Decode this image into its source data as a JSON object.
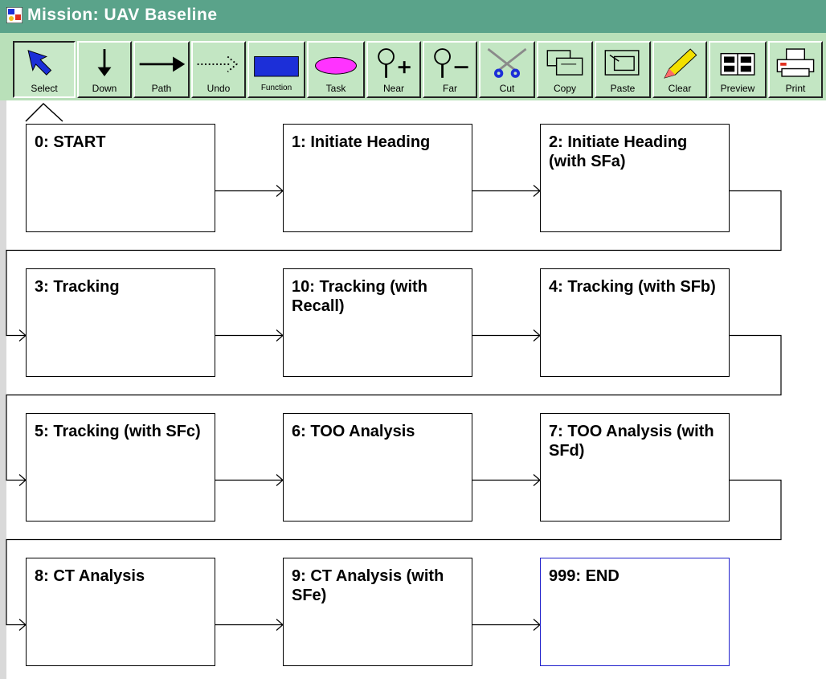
{
  "window": {
    "title": "Mission: UAV Baseline"
  },
  "toolbar": {
    "buttons": [
      {
        "label": "Select",
        "icon": "select-arrow-icon",
        "selected": true
      },
      {
        "label": "Down",
        "icon": "down-arrow-icon"
      },
      {
        "label": "Path",
        "icon": "path-arrow-icon"
      },
      {
        "label": "Undo",
        "icon": "undo-dotted-arrow-icon"
      },
      {
        "label": "Function",
        "icon": "function-rectangle-icon"
      },
      {
        "label": "Task",
        "icon": "task-ellipse-icon"
      },
      {
        "label": "Near",
        "icon": "zoom-in-icon"
      },
      {
        "label": "Far",
        "icon": "zoom-out-icon"
      },
      {
        "label": "Cut",
        "icon": "scissors-icon"
      },
      {
        "label": "Copy",
        "icon": "copy-icon"
      },
      {
        "label": "Paste",
        "icon": "paste-icon"
      },
      {
        "label": "Clear",
        "icon": "eraser-pencil-icon"
      },
      {
        "label": "Preview",
        "icon": "preview-icon"
      },
      {
        "label": "Print",
        "icon": "printer-icon"
      }
    ]
  },
  "colors": {
    "titlebar": "#5aa38a",
    "toolbar": "#b9e0b9",
    "function_button": "#1c2fd8",
    "task_button": "#ff33ff",
    "end_node_border": "#2020cc"
  },
  "diagram": {
    "nodes": [
      {
        "id": "0",
        "label": "0: START"
      },
      {
        "id": "1",
        "label": "1: Initiate Heading"
      },
      {
        "id": "2",
        "label": "2: Initiate Heading (with SFa)"
      },
      {
        "id": "3",
        "label": "3: Tracking"
      },
      {
        "id": "10",
        "label": "10: Tracking (with Recall)"
      },
      {
        "id": "4",
        "label": "4: Tracking (with SFb)"
      },
      {
        "id": "5",
        "label": "5: Tracking (with SFc)"
      },
      {
        "id": "6",
        "label": "6: TOO Analysis"
      },
      {
        "id": "7",
        "label": "7: TOO Analysis (with SFd)"
      },
      {
        "id": "8",
        "label": "8: CT Analysis"
      },
      {
        "id": "9",
        "label": "9: CT Analysis (with SFe)"
      },
      {
        "id": "999",
        "label": "999: END",
        "end": true
      }
    ],
    "edges": [
      [
        "0",
        "1"
      ],
      [
        "1",
        "2"
      ],
      [
        "2",
        "3"
      ],
      [
        "3",
        "10"
      ],
      [
        "10",
        "4"
      ],
      [
        "4",
        "5"
      ],
      [
        "5",
        "6"
      ],
      [
        "6",
        "7"
      ],
      [
        "7",
        "8"
      ],
      [
        "8",
        "9"
      ],
      [
        "9",
        "999"
      ]
    ]
  }
}
